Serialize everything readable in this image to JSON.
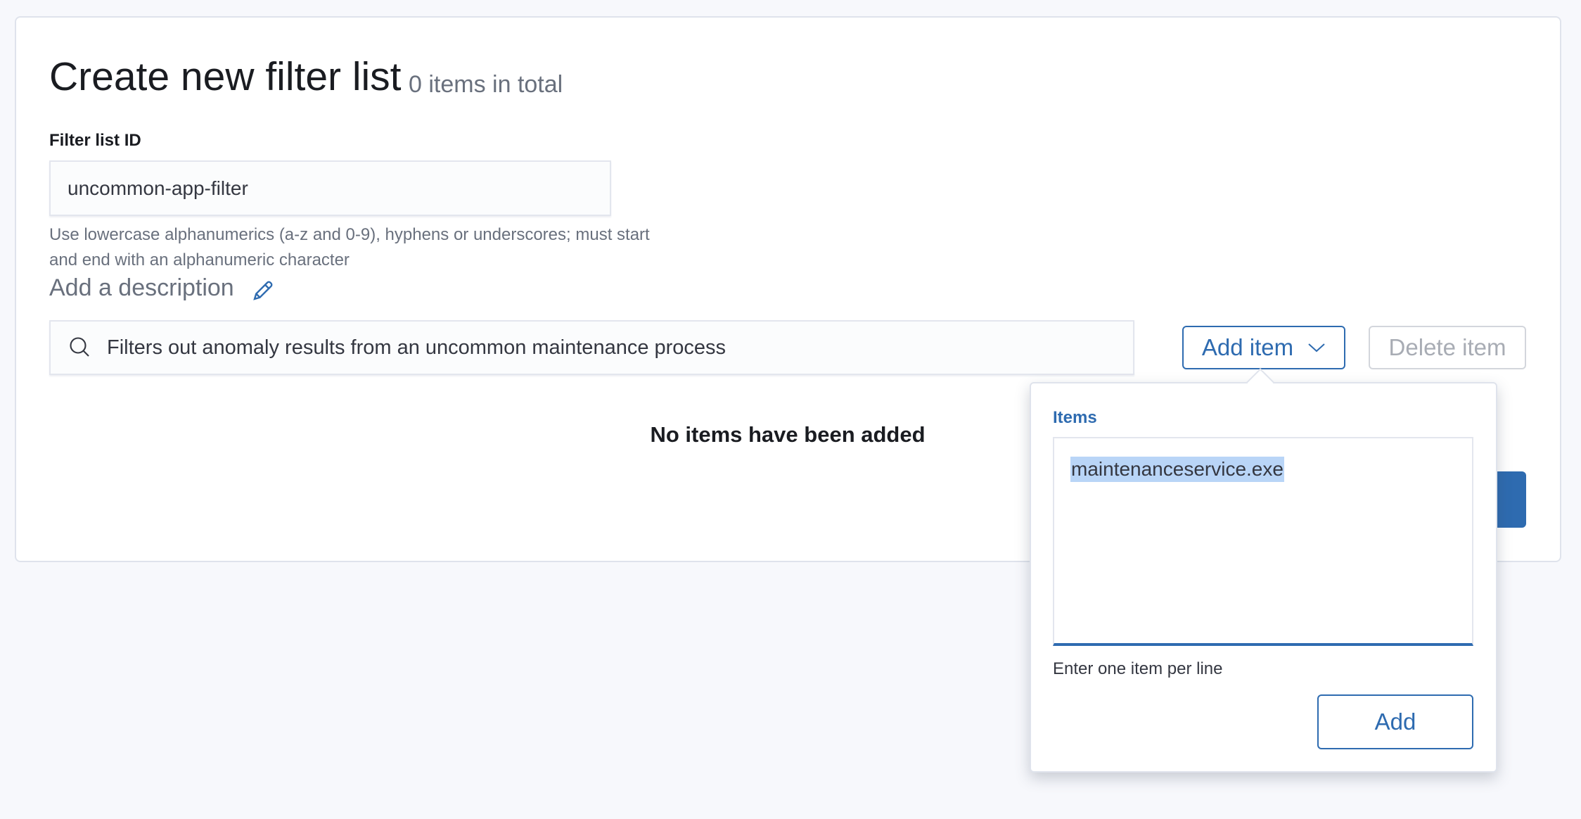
{
  "header": {
    "title": "Create new filter list",
    "count": "0 items in total"
  },
  "form": {
    "id_label": "Filter list ID",
    "id_value": "uncommon-app-filter",
    "id_help": "Use lowercase alphanumerics (a-z and 0-9), hyphens or underscores; must start and end with an alphanumeric character",
    "description_label": "Add a description",
    "search_value": "Filters out anomaly results from an uncommon maintenance process"
  },
  "toolbar": {
    "add_item": "Add item",
    "delete_item": "Delete item"
  },
  "empty_message": "No items have been added",
  "popover": {
    "label": "Items",
    "textarea_value": "maintenanceservice.exe",
    "help": "Enter one item per line",
    "add_button": "Add"
  },
  "colors": {
    "accent": "#2e6bb0",
    "selection": "#b9d5f7"
  }
}
